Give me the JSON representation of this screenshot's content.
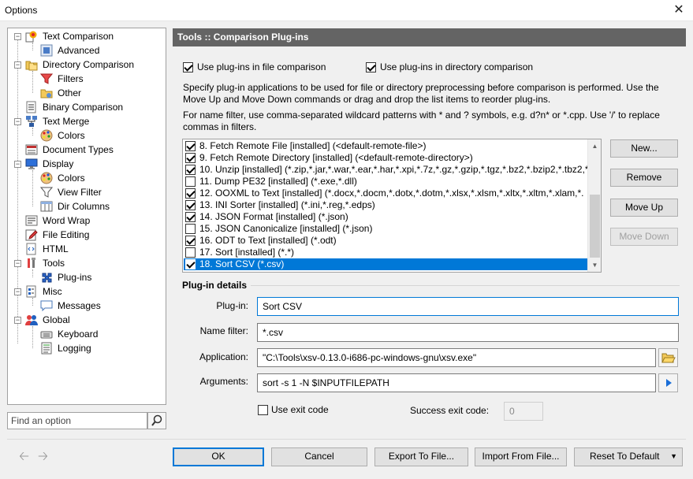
{
  "window": {
    "title": "Options",
    "close_glyph": "✕"
  },
  "tree": {
    "items": [
      {
        "label": "Text Comparison",
        "icon": "text-compare-icon"
      },
      {
        "label": "Advanced",
        "icon": "advanced-icon"
      },
      {
        "label": "Directory Comparison",
        "icon": "folder-compare-icon"
      },
      {
        "label": "Filters",
        "icon": "filter-icon"
      },
      {
        "label": "Other",
        "icon": "folder-other-icon"
      },
      {
        "label": "Binary Comparison",
        "icon": "binary-icon"
      },
      {
        "label": "Text Merge",
        "icon": "merge-icon"
      },
      {
        "label": "Colors",
        "icon": "palette-icon"
      },
      {
        "label": "Document Types",
        "icon": "document-types-icon"
      },
      {
        "label": "Display",
        "icon": "monitor-icon"
      },
      {
        "label": "Colors",
        "icon": "palette-icon"
      },
      {
        "label": "View Filter",
        "icon": "filter-icon"
      },
      {
        "label": "Dir Columns",
        "icon": "columns-icon"
      },
      {
        "label": "Word Wrap",
        "icon": "word-wrap-icon"
      },
      {
        "label": "File Editing",
        "icon": "pencil-icon"
      },
      {
        "label": "HTML",
        "icon": "html-icon"
      },
      {
        "label": "Tools",
        "icon": "tools-icon"
      },
      {
        "label": "Plug-ins",
        "icon": "plugin-icon"
      },
      {
        "label": "Misc",
        "icon": "misc-icon"
      },
      {
        "label": "Messages",
        "icon": "message-icon"
      },
      {
        "label": "Global",
        "icon": "users-icon"
      },
      {
        "label": "Keyboard",
        "icon": "keyboard-icon"
      },
      {
        "label": "Logging",
        "icon": "log-icon"
      }
    ]
  },
  "search": {
    "placeholder": "Find an option"
  },
  "panel": {
    "header": "Tools :: Comparison Plug-ins",
    "use_file_plugins": "Use plug-ins in file comparison",
    "use_dir_plugins": "Use plug-ins in directory comparison",
    "desc1_line1": "Specify plug-in applications to be used for file or directory preprocessing before comparison is performed. Use the",
    "desc1_line2": "Move Up and Move Down commands or drag and drop the list items to reorder plug-ins.",
    "desc2_line1": "For name filter, use comma-separated wildcard patterns with * and ? symbols, e.g. d?n* or *.cpp. Use '/' to replace",
    "desc2_line2": "commas in filters."
  },
  "plugins": [
    {
      "label": "8. Fetch Remote File [installed] (<default-remote-file>)",
      "checked": true
    },
    {
      "label": "9. Fetch Remote Directory [installed] (<default-remote-directory>)",
      "checked": true
    },
    {
      "label": "10. Unzip [installed] (*.zip,*.jar,*.war,*.ear,*.har,*.xpi,*.7z,*.gz,*.gzip,*.tgz,*.bz2,*.bzip2,*.tbz2,*.tb",
      "checked": true
    },
    {
      "label": "11. Dump PE32 [installed] (*.exe,*.dll)",
      "checked": false
    },
    {
      "label": "12. OOXML to Text [installed] (*.docx,*.docm,*.dotx,*.dotm,*.xlsx,*.xlsm,*.xltx,*.xltm,*.xlam,*.",
      "checked": true
    },
    {
      "label": "13. INI Sorter [installed] (*.ini,*.reg,*.edps)",
      "checked": true
    },
    {
      "label": "14. JSON Format [installed] (*.json)",
      "checked": true
    },
    {
      "label": "15. JSON Canonicalize [installed] (*.json)",
      "checked": false
    },
    {
      "label": "16. ODT to Text [installed] (*.odt)",
      "checked": true
    },
    {
      "label": "17. Sort [installed] (*.*)",
      "checked": false
    },
    {
      "label": "18. Sort CSV (*.csv)",
      "checked": true,
      "selected": true
    }
  ],
  "list_buttons": {
    "new": "New...",
    "remove": "Remove",
    "move_up": "Move Up",
    "move_down": "Move Down"
  },
  "details": {
    "title": "Plug-in details",
    "plugin_label": "Plug-in:",
    "plugin_value": "Sort CSV",
    "name_filter_label": "Name filter:",
    "name_filter_value": "*.csv",
    "application_label": "Application:",
    "application_value": "\"C:\\Tools\\xsv-0.13.0-i686-pc-windows-gnu\\xsv.exe\"",
    "arguments_label": "Arguments:",
    "arguments_value": "sort -s 1 -N $INPUTFILEPATH",
    "use_exit_code": "Use exit code",
    "success_exit_label": "Success exit code:",
    "success_exit_value": "0"
  },
  "footer": {
    "ok": "OK",
    "cancel": "Cancel",
    "export": "Export To File...",
    "import": "Import From File...",
    "reset": "Reset To Default"
  },
  "colors": {
    "selection": "#0078d7",
    "header_bg": "#646464"
  }
}
